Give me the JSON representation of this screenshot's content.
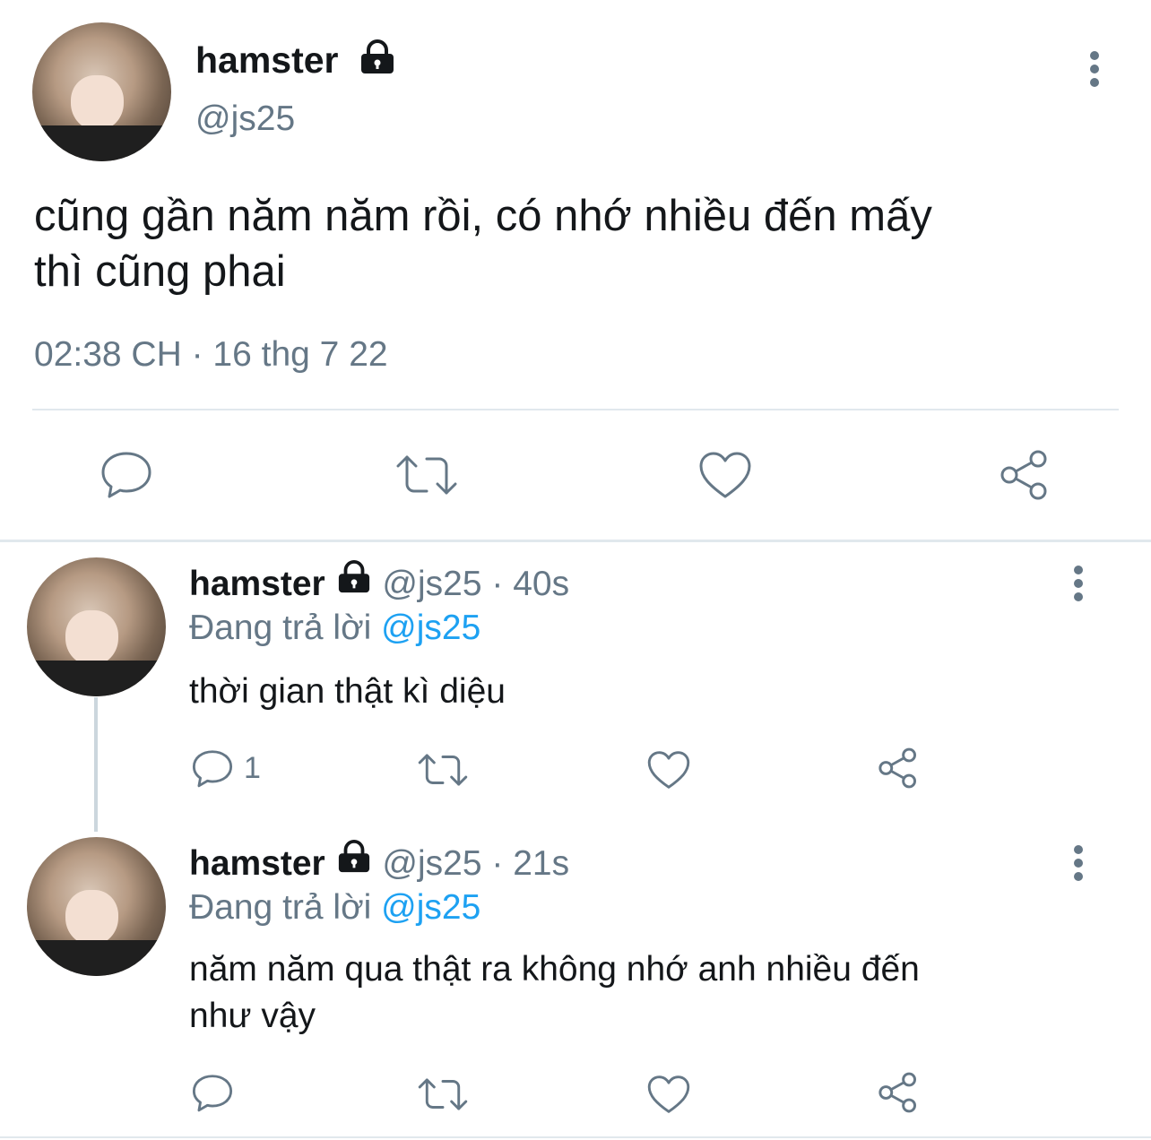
{
  "main_tweet": {
    "display_name": "hamster",
    "handle": "@js25",
    "text_line1": "cũng gần năm năm rồi, có nhớ nhiều đến mấy",
    "text_line2": "thì cũng phai",
    "timestamp": "02:38 CH · 16 thg 7 22",
    "actions": [
      "reply-icon",
      "retweet-icon",
      "like-icon",
      "share-icon"
    ]
  },
  "replies": [
    {
      "display_name": "hamster",
      "handle": "@js25",
      "time": "· 40s",
      "replying_prefix": "Đang trả lời",
      "replying_to": "@js25",
      "text_line1": "thời gian thật kì diệu",
      "text_line2": "",
      "reply_count": "1"
    },
    {
      "display_name": "hamster",
      "handle": "@js25",
      "time": "· 21s",
      "replying_prefix": "Đang trả lời",
      "replying_to": "@js25",
      "text_line1": "năm năm qua thật ra không nhớ anh nhiều đến",
      "text_line2": "như vậy",
      "reply_count": ""
    }
  ],
  "colors": {
    "text": "#14171a",
    "secondary": "#657786",
    "link": "#1da1f2",
    "divider": "#e1e8ed"
  }
}
